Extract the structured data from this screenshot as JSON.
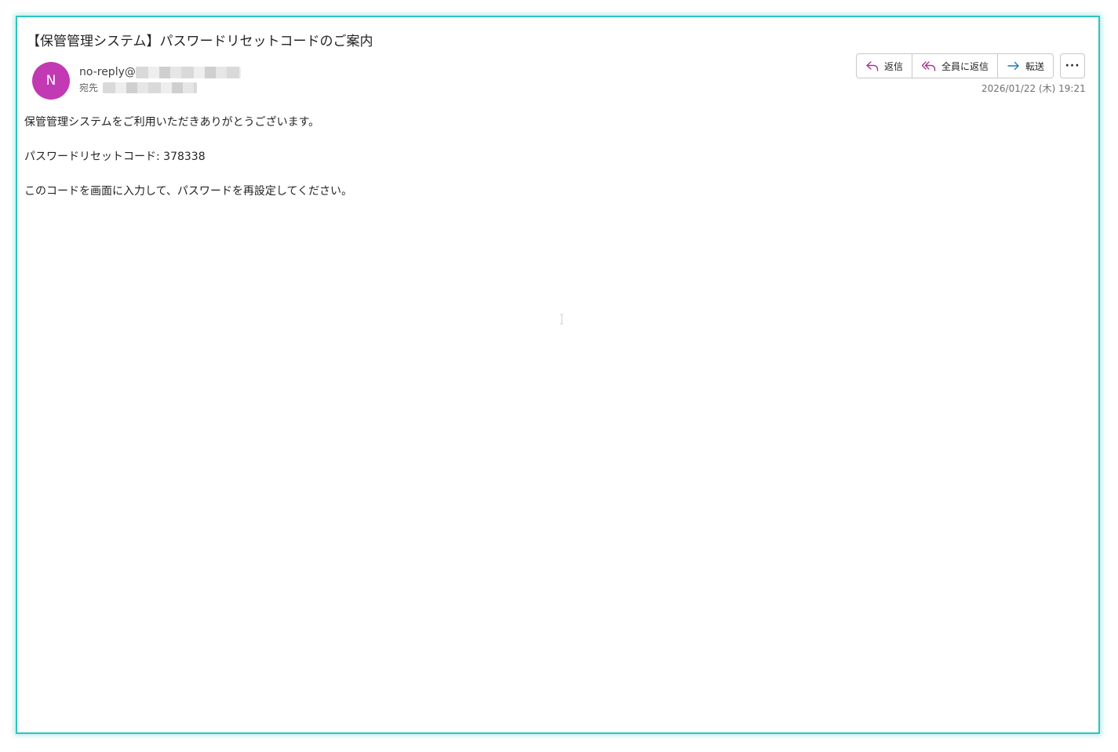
{
  "message": {
    "subject": "【保管管理システム】パスワードリセットコードのご案内",
    "sender_initial": "N",
    "sender_name": "no-reply@",
    "to_label": "宛先",
    "date": "2026/01/22 (木) 19:21",
    "body": [
      "保管管理システムをご利用いただきありがとうございます。",
      "パスワードリセットコード: 378338",
      "このコードを画面に入力して、パスワードを再設定してください。"
    ]
  },
  "actions": {
    "reply_label": "返信",
    "reply_all_label": "全員に返信",
    "forward_label": "転送",
    "more_label": "···"
  },
  "icons": {
    "reply": "reply-icon",
    "reply_all": "reply-all-icon",
    "forward": "forward-icon",
    "more": "more-icon"
  },
  "colors": {
    "avatar": "#c239b3",
    "frame_border": "#2ec4c0",
    "reply_icon": "#a4378f",
    "forward_icon": "#1f7ab8"
  }
}
